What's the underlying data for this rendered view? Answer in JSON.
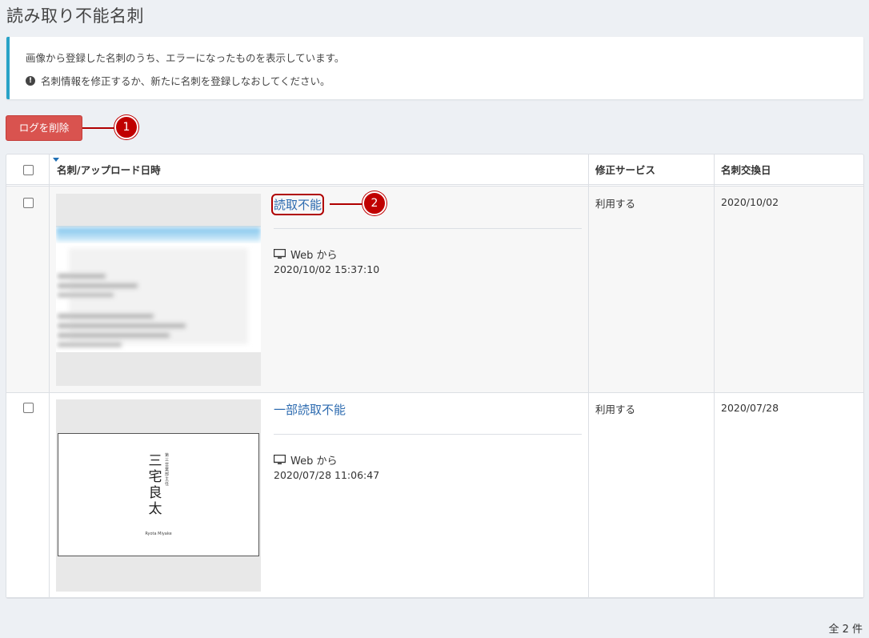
{
  "page": {
    "title": "読み取り不能名刺"
  },
  "info": {
    "line1": "画像から登録した名刺のうち、エラーになったものを表示しています。",
    "line2": "名刺情報を修正するか、新たに名刺を登録しなおしてください。",
    "icon": "exclamation-circle-icon"
  },
  "toolbar": {
    "delete_label": "ログを削除"
  },
  "callouts": {
    "one": "1",
    "two": "2"
  },
  "table": {
    "headers": {
      "card": "名刺/アップロード日時",
      "service": "修正サービス",
      "exchange_date": "名刺交換日"
    },
    "rows": [
      {
        "status": "読取不能",
        "source": "Web から",
        "uploaded": "2020/10/02 15:37:10",
        "service": "利用する",
        "exchange_date": "2020/10/02"
      },
      {
        "status": "一部読取不能",
        "source": "Web から",
        "uploaded": "2020/07/28 11:06:47",
        "service": "利用する",
        "exchange_date": "2020/07/28",
        "card_name": "三宅 良太",
        "card_romaji": "Ryota Miyake",
        "card_title": "第三営業部 主任"
      }
    ]
  },
  "footer": {
    "count": "全 2 件"
  },
  "colors": {
    "accent": "#29a3c7",
    "danger": "#d9534f",
    "link": "#2d6bb0",
    "callout": "#c00000"
  }
}
